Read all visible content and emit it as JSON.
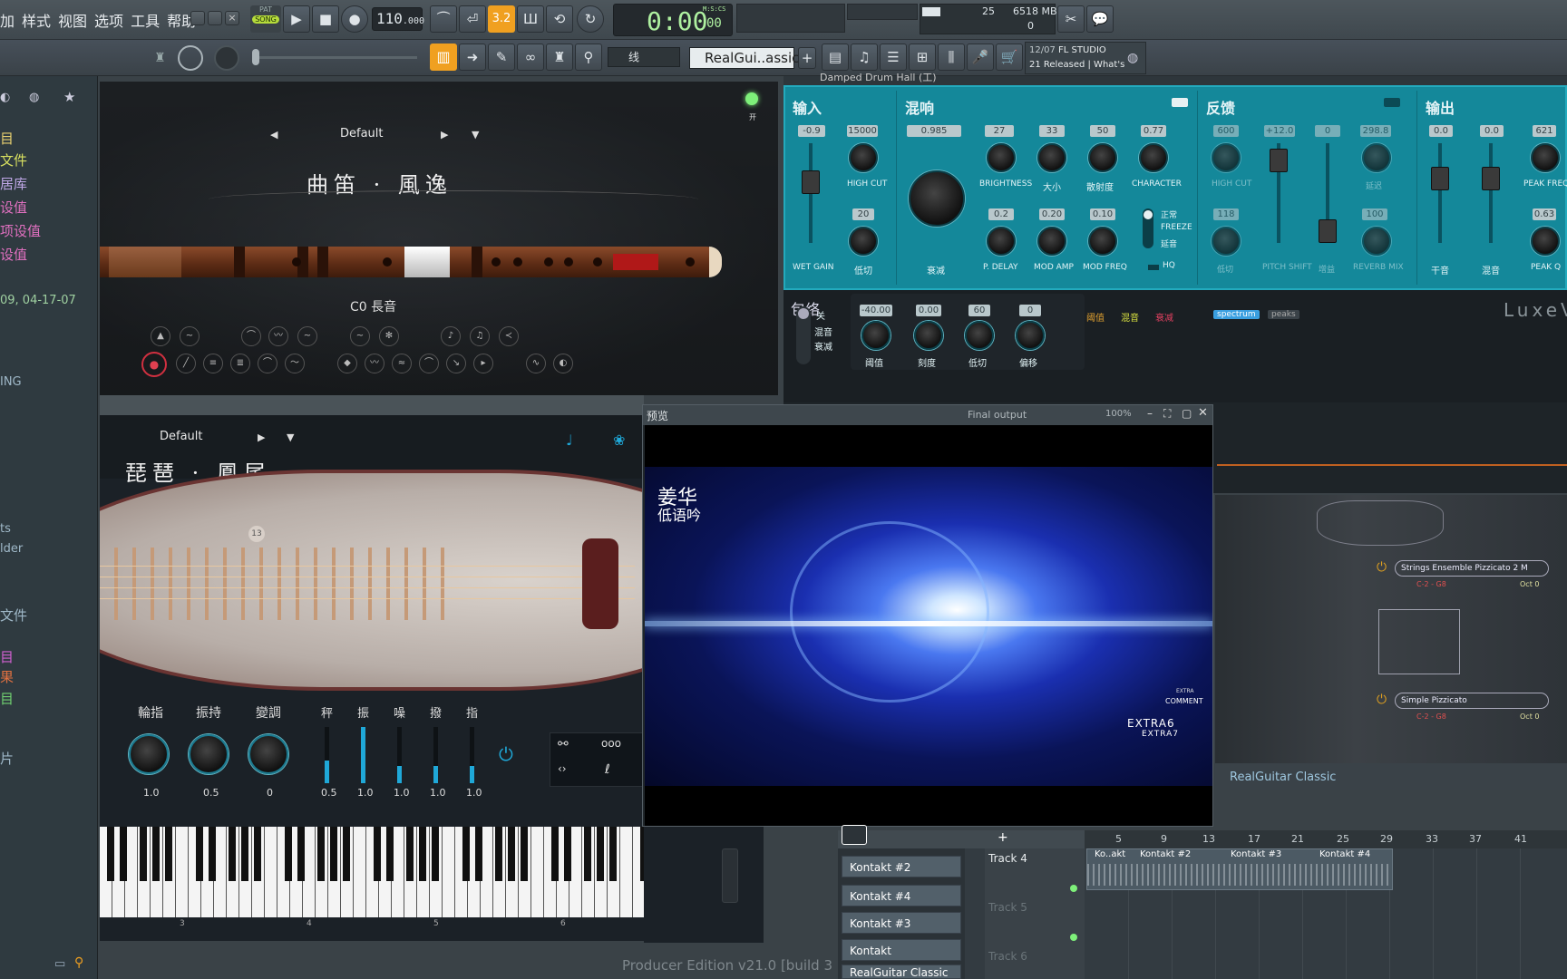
{
  "menu": {
    "items": [
      "加",
      "样式",
      "视图",
      "选项",
      "工具",
      "帮助"
    ]
  },
  "transport": {
    "pat_label": "PAT",
    "song_label": "SONG",
    "tempo_main": "110",
    "tempo_fraction": ".000",
    "time_main": "0:00",
    "time_fraction": "00",
    "time_unit": "M:S:CS",
    "step_value": "3.2",
    "memory_value": "25",
    "memory_mb": "6518 MB",
    "memory_zero": "0"
  },
  "toolbar2": {
    "snap_label": "线",
    "channel_name": "RealGui..assic",
    "news_date": "12/07",
    "news_title": "FL STUDIO",
    "news_text": "21 Released | What's"
  },
  "browser": {
    "items": [
      "目",
      "文件",
      "居库",
      "设值",
      "项设值",
      "设值",
      "09, 04-17-07",
      "ING",
      "ts",
      "lder",
      "文件",
      "目",
      "果",
      "目",
      "片"
    ]
  },
  "dizi": {
    "preset": "Default",
    "title": "曲笛 · 風逸",
    "note": "C0 長音",
    "power_label": "开"
  },
  "pipa": {
    "preset": "Default",
    "title": "琵琶 · 鳳尾",
    "fret_number": "13",
    "controls": [
      {
        "label": "輪指",
        "value": "1.0"
      },
      {
        "label": "振持",
        "value": "0.5"
      },
      {
        "label": "變調",
        "value": "0"
      }
    ],
    "sliders": [
      {
        "label": "秤",
        "value": "0.5"
      },
      {
        "label": "振",
        "value": "1.0"
      },
      {
        "label": "噪",
        "value": "1.0"
      },
      {
        "label": "撥",
        "value": "1.0"
      },
      {
        "label": "指",
        "value": "1.0"
      }
    ],
    "octave_labels": [
      "3",
      "4",
      "5",
      "6"
    ]
  },
  "luxe": {
    "header_title": "Damped Drum Hall (工)",
    "sections": {
      "input": "输入",
      "reverb": "混响",
      "feedback": "反馈",
      "output": "输出"
    },
    "input": {
      "wet_gain_value": "-0.9",
      "wet_gain_label": "WET GAIN",
      "high_cut_value": "15000",
      "high_cut_label": "HIGH CUT",
      "low_cut_value": "20",
      "low_cut_label": "低切"
    },
    "reverb": {
      "decay_value": "0.985",
      "decay_label": "衰减",
      "brightness_value": "27",
      "brightness_label": "BRIGHTNESS",
      "size_value": "33",
      "size_label": "大小",
      "diffusion_value": "50",
      "diffusion_label": "散射度",
      "character_value": "0.77",
      "character_label": "CHARACTER",
      "pdelay_value": "0.2",
      "pdelay_label": "P. DELAY",
      "modamp_value": "0.20",
      "modamp_label": "MOD AMP",
      "modfreq_value": "0.10",
      "modfreq_label": "MOD FREQ",
      "mode_normal": "正常",
      "mode_freeze": "FREEZE",
      "mode_delay": "延音",
      "hq_label": "HQ"
    },
    "feedback": {
      "hc_value": "600",
      "hc_label": "HIGH CUT",
      "pitch_value": "+12.0",
      "pitch_label": "PITCH SHIFT",
      "fb_value": "0",
      "fb_label": "增益",
      "delay_value": "298.8",
      "delay_label": "延迟",
      "lc_value": "118",
      "lc_label": "低切",
      "mix_value": "100",
      "mix_label": "REVERB MIX"
    },
    "output": {
      "dry_value": "0.0",
      "dry_label": "干音",
      "wet_value": "0.0",
      "wet_label": "混音",
      "peakfreq_value": "621",
      "peakfreq_label": "PEAK FREQ",
      "peakq_value": "0.63",
      "peakq_label": "PEAK Q"
    },
    "envelope": {
      "title": "包络",
      "legend": [
        "包络",
        "阈值",
        "混音",
        "衰减"
      ],
      "legend_colors": [
        "#3a9fe0",
        "#e0a030",
        "#d8e040",
        "#e04060"
      ],
      "tabs": [
        "spectrum",
        "peaks"
      ],
      "modes": [
        "关",
        "混音",
        "衰减"
      ],
      "knobs": [
        {
          "value": "-40.00",
          "label": "阈值"
        },
        {
          "value": "0.00",
          "label": "刻度"
        },
        {
          "value": "60",
          "label": "低切"
        },
        {
          "value": "0",
          "label": "偏移"
        }
      ]
    },
    "brand": "LuxeV"
  },
  "preview": {
    "title": "预览",
    "output": "Final output",
    "zoom": "100%",
    "overlay_title": "姜华",
    "overlay_subtitle": "低语吟",
    "watermark_small": "EXTRA",
    "watermark_comment": "COMMENT",
    "watermark_extra6": "EXTRA6",
    "watermark_extra7": "EXTRA7"
  },
  "kontakt": {
    "inst1": "Strings Ensemble Pizzicato 2 M",
    "inst1_range": "C-2  -  G8",
    "inst1_oct": "Oct  0",
    "inst2": "Simple Pizzicato",
    "inst2_range": "C-2  -  G8",
    "inst2_oct": "Oct  0",
    "channel_label": "RealGuitar Classic"
  },
  "playlist": {
    "ruler": [
      "5",
      "9",
      "13",
      "17",
      "21",
      "25",
      "29",
      "33",
      "37",
      "41"
    ],
    "tracks": [
      "Track 4",
      "Track 5",
      "Track 6"
    ],
    "channels": [
      "Kontakt #2",
      "Kontakt #4",
      "Kontakt #3",
      "Kontakt",
      "RealGuitar Classic"
    ],
    "clips": [
      "Ko..akt",
      "Kontakt #2",
      "Kontakt #3",
      "Kontakt #4"
    ]
  },
  "status": {
    "edition": "Producer Edition v21.0 [build 3"
  },
  "colors": {
    "accent_orange": "#f0a020",
    "luxe_teal": "#14889a",
    "lcd_green": "#aef0a0"
  }
}
